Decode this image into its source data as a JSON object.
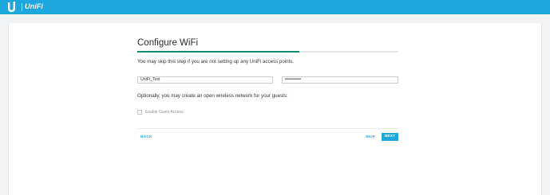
{
  "header": {
    "brand": "UniFi",
    "logo_icon": "ubiquiti-u-logo-icon",
    "bar_color": "#1ea6df"
  },
  "wizard": {
    "title": "Configure WiFi",
    "progress_percent": 62,
    "progress_color": "#0e8c6e",
    "subtitle": "You may skip this step if you are not setting up any UniFi access points.",
    "ssid_value": "UniFi_Test",
    "password_value": "••••••••••",
    "optional_text": "Optionally, you may create an open wireless network for your guests:",
    "guest_access_label": "Enable Guest Access",
    "guest_access_checked": false,
    "back_label": "BACK",
    "skip_label": "SKIP",
    "next_label": "NEXT"
  }
}
